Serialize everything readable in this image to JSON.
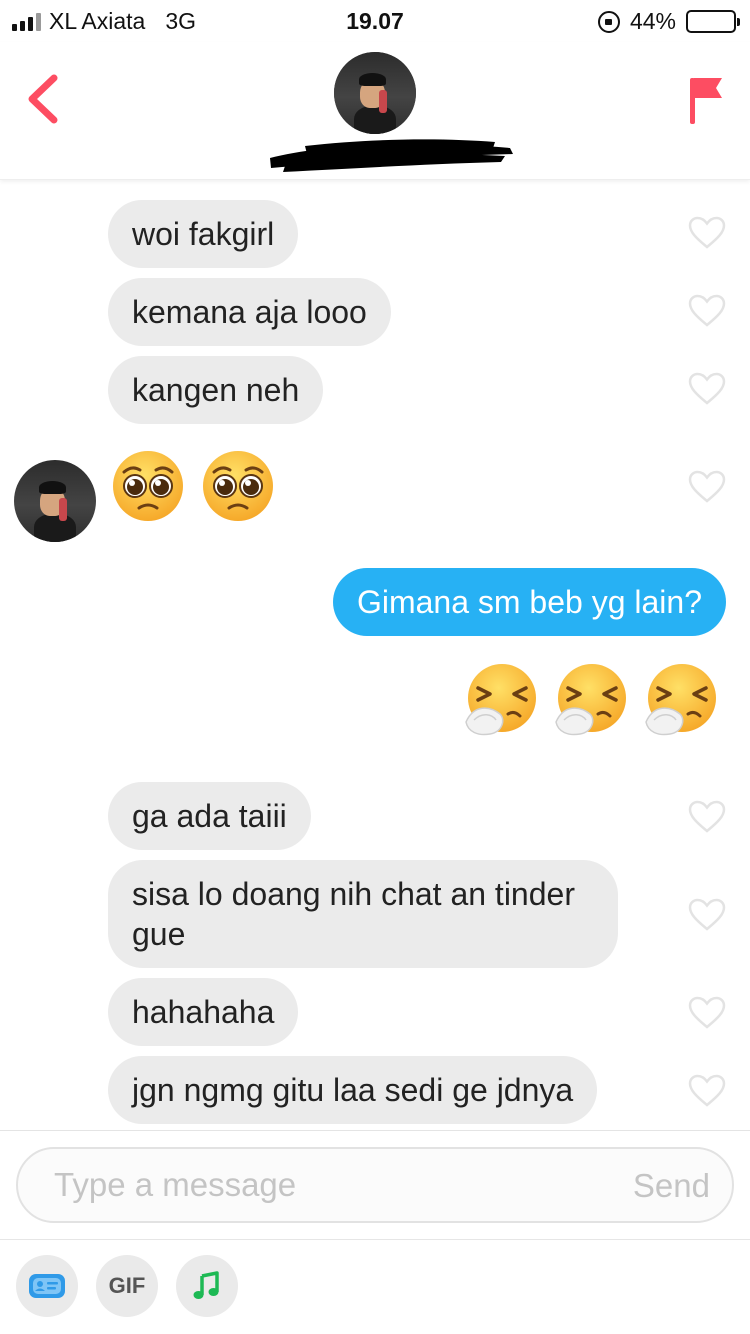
{
  "status_bar": {
    "carrier": "XL Axiata",
    "network": "3G",
    "time": "19.07",
    "battery": "44%",
    "battery_level": 0.44
  },
  "header": {
    "match_name": ""
  },
  "messages": [
    {
      "id": "m1",
      "side": "incoming",
      "text": "woi fakgirl",
      "liked": false
    },
    {
      "id": "m2",
      "side": "incoming",
      "text": "kemana aja looo",
      "liked": false
    },
    {
      "id": "m3",
      "side": "incoming",
      "text": "kangen neh",
      "liked": false
    },
    {
      "id": "m4",
      "side": "incoming",
      "emoji": [
        "pleading-face",
        "pleading-face"
      ],
      "text": "🥺🥺",
      "liked": false
    },
    {
      "id": "m5",
      "side": "outgoing",
      "text": "Gimana sm beb yg lain?"
    },
    {
      "id": "m6",
      "side": "outgoing",
      "emoji": [
        "sneezing-face",
        "sneezing-face",
        "sneezing-face"
      ],
      "text": "🤧🤧🤧"
    },
    {
      "id": "m7",
      "side": "incoming",
      "text": "ga ada taiii",
      "liked": false
    },
    {
      "id": "m8",
      "side": "incoming",
      "text": "sisa lo doang nih chat an tinder\ngue",
      "liked": false
    },
    {
      "id": "m9",
      "side": "incoming",
      "text": "hahahaha",
      "liked": false
    },
    {
      "id": "m10",
      "side": "incoming",
      "text": "jgn ngmg gitu laa sedi ge jdnya",
      "liked": false
    }
  ],
  "composer": {
    "placeholder": "Type a message",
    "value": "",
    "send_label": "Send"
  },
  "toolbar": {
    "gif_label": "GIF"
  },
  "colors": {
    "accent": "#fd4d62",
    "outgoing_bubble": "#27b1f4",
    "incoming_bubble": "#ebebeb",
    "spotify_green": "#1db954",
    "contact_blue": "#2f9ae8"
  }
}
